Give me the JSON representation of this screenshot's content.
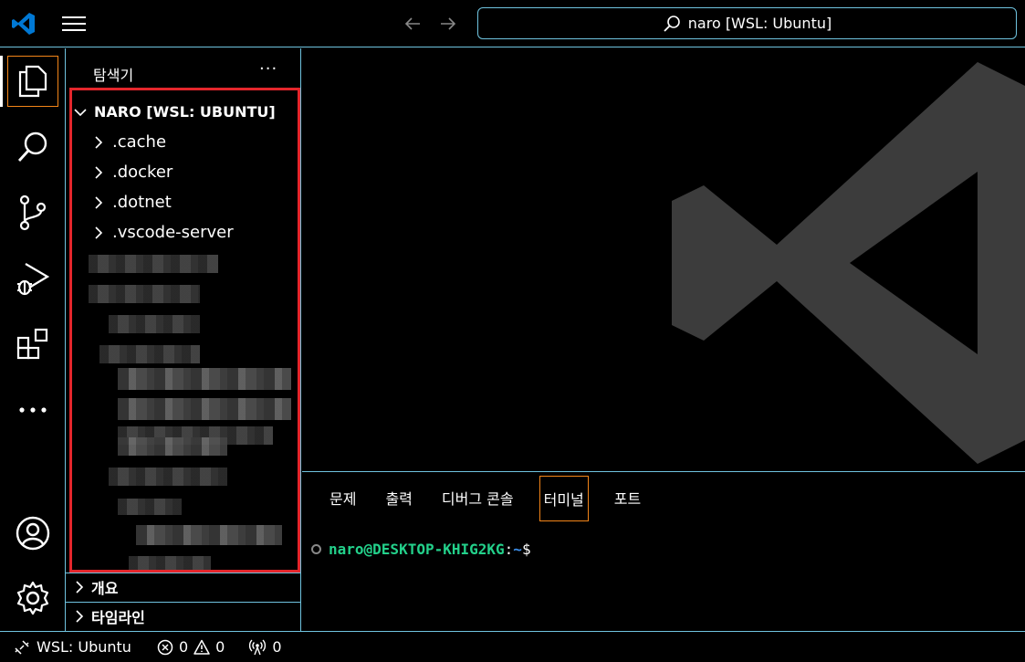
{
  "titlebar": {
    "search_text": "naro [WSL: Ubuntu]"
  },
  "activitybar": {
    "items": [
      "explorer-icon",
      "search-icon",
      "source-control-icon",
      "run-debug-icon",
      "extensions-icon",
      "more-icon",
      "account-icon",
      "settings-gear-icon"
    ]
  },
  "sidebar": {
    "title": "탐색기",
    "more": "···",
    "root_folder": "NARO [WSL: UBUNTU]",
    "items": [
      {
        "label": ".cache"
      },
      {
        "label": ".docker"
      },
      {
        "label": ".dotnet"
      },
      {
        "label": ".vscode-server"
      }
    ],
    "sections": {
      "outline": "개요",
      "timeline": "타임라인"
    }
  },
  "panel": {
    "tabs": [
      {
        "label": "문제"
      },
      {
        "label": "출력"
      },
      {
        "label": "디버그 콘솔"
      },
      {
        "label": "터미널"
      },
      {
        "label": "포트"
      }
    ],
    "active_tab": "터미널",
    "terminal": {
      "user_host": "naro@DESKTOP-KHIG2KG",
      "colon": ":",
      "path": "~",
      "prompt": "$"
    }
  },
  "statusbar": {
    "remote": "WSL: Ubuntu",
    "errors": "0",
    "warnings": "0",
    "ports": "0"
  },
  "colors": {
    "border": "#6fc3df",
    "active_outline": "#f38518",
    "highlight_box": "#e4262c",
    "terminal_user": "#23d18b",
    "terminal_path": "#3b8eea",
    "logo_watermark": "#3c3c3c",
    "vscode_blue": "#0078d4"
  }
}
